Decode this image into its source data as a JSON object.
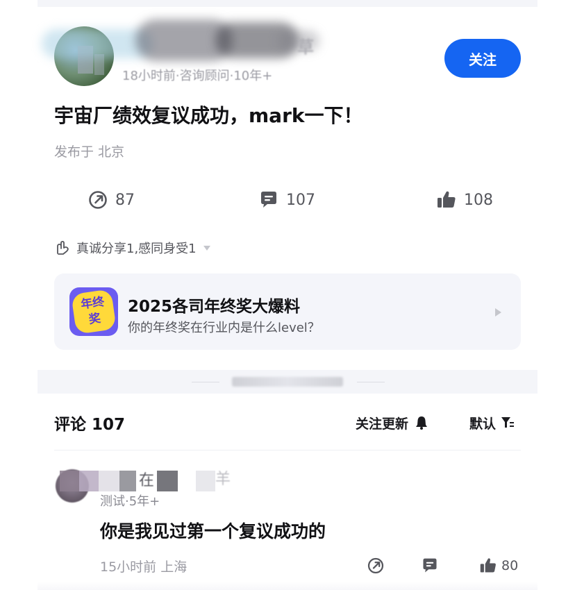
{
  "post": {
    "author_name_tail": "草",
    "author_meta": "18小时前·咨询顾问·10年+",
    "follow_label": "关注",
    "title": "宇宙厂绩效复议成功，mark一下！",
    "location": "发布于 北京",
    "actions": {
      "share_count": "87",
      "comment_count": "107",
      "like_count": "108"
    },
    "reaction_summary": "真诚分享1,感同身受1"
  },
  "promo": {
    "badge_chars": [
      "年",
      "终",
      "奖"
    ],
    "title": "2025各司年终奖大爆料",
    "subtitle": "你的年终奖在行业内是什么level？"
  },
  "comments_header": {
    "title": "评论 107",
    "follow_updates_label": "关注更新",
    "sort_label": "默认"
  },
  "comment": {
    "name_visible": "在",
    "name_tail": "羊",
    "meta": "测试·5年+",
    "text": "你是我见过第一个复议成功的",
    "footer_meta": "15小时前  上海",
    "like_count": "80"
  },
  "colors": {
    "accent": "#1565f2",
    "promo_badge_bg": "#6b5cf0",
    "promo_badge_seal": "#ffd93a",
    "muted_text": "#9a9aa2",
    "icon_gray": "#55565c"
  },
  "icons": {
    "share": "share-arrow-icon",
    "comment": "comment-bubble-icon",
    "like": "thumbs-up-icon",
    "reaction": "reaction-hands-icon",
    "bell": "bell-icon",
    "filter": "filter-sort-icon"
  }
}
